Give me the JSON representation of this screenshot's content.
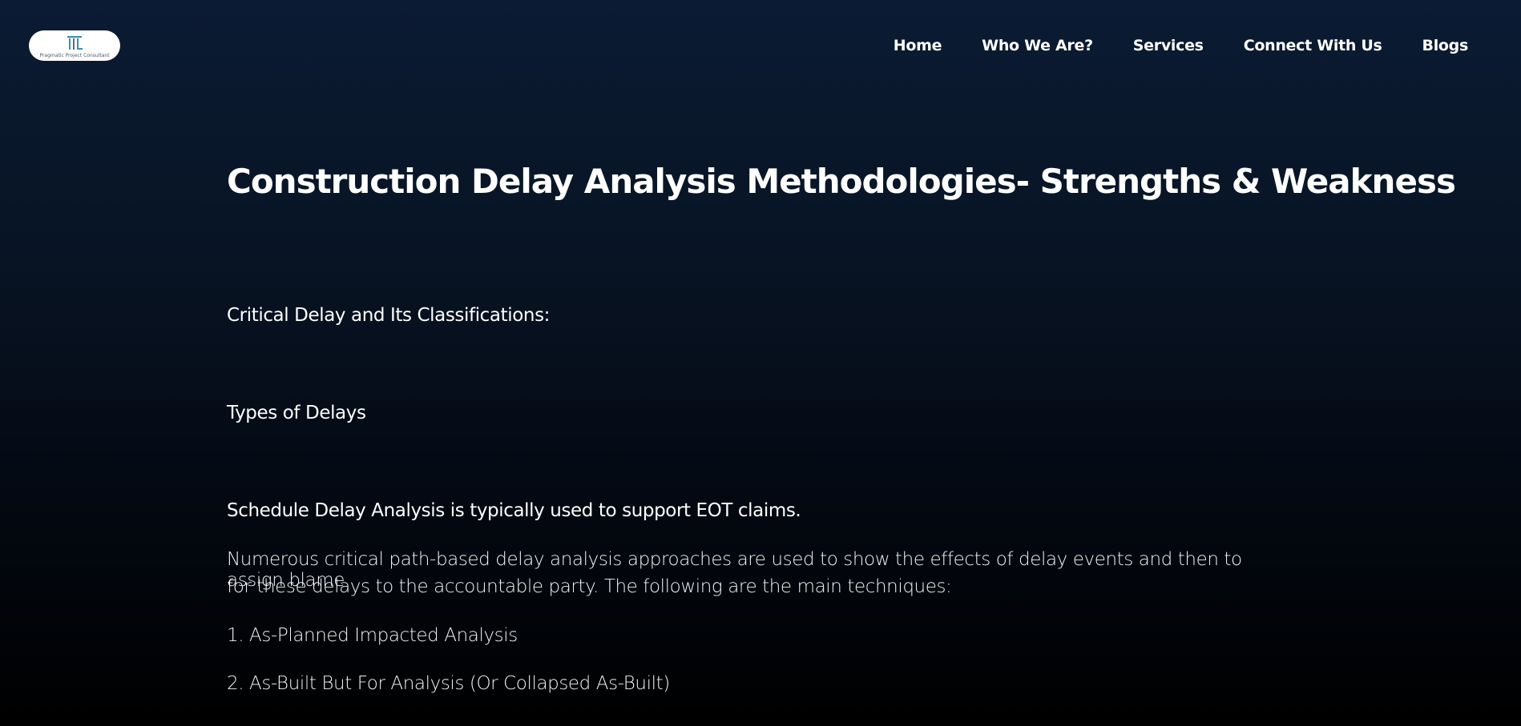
{
  "header": {
    "logo_text": "Pragmatic Project Consultant",
    "nav": [
      {
        "label": "Home"
      },
      {
        "label": "Who We Are?"
      },
      {
        "label": "Services"
      },
      {
        "label": "Connect With Us"
      },
      {
        "label": "Blogs"
      }
    ]
  },
  "article": {
    "title": "Construction Delay Analysis Methodologies- Strengths & Weakness",
    "section_1": "Critical Delay and Its Classifications:",
    "section_2": "Types of Delays",
    "section_3": "Schedule Delay Analysis is typically used to support EOT claims.",
    "intro_line_1": "Numerous critical path-based delay analysis approaches are used to show the effects of delay events and then to assign blame",
    "intro_line_2": "for these delays to the accountable party. The following are the main techniques:",
    "list": [
      "1. As-Planned Impacted Analysis",
      "2. As-Built But For Analysis (Or Collapsed As-Built)"
    ]
  },
  "colors": {
    "background_top": "#0b1b33",
    "background_bottom": "#000000",
    "text": "#ffffff"
  }
}
